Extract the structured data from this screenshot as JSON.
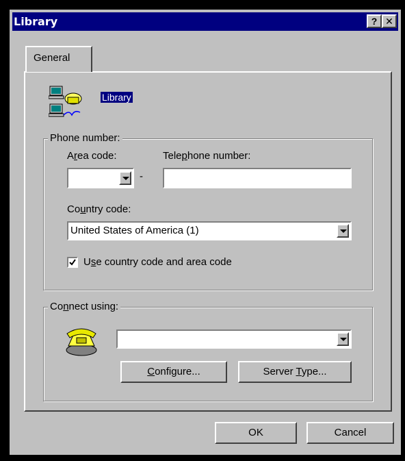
{
  "window": {
    "title": "Library",
    "help_button": "?",
    "close_button": "✕"
  },
  "tabs": [
    {
      "label": "General"
    }
  ],
  "header": {
    "connection_name": "Library",
    "icon": "network-computers-icon"
  },
  "phone_group": {
    "legend": "Phone number:",
    "area_code_label_pre": "A",
    "area_code_label_u": "r",
    "area_code_label_post": "ea code:",
    "area_code_value": "",
    "dash": "-",
    "telephone_label_pre": "Tele",
    "telephone_label_u": "p",
    "telephone_label_post": "hone number:",
    "telephone_value": "",
    "country_label_pre": "Co",
    "country_label_u": "u",
    "country_label_post": "ntry code:",
    "country_value": "United States of America (1)",
    "use_codes_pre": "U",
    "use_codes_u": "s",
    "use_codes_post": "e country code and area code",
    "use_codes_checked": true
  },
  "connect_group": {
    "legend_pre": "Co",
    "legend_u": "n",
    "legend_post": "nect using:",
    "device_value": "",
    "icon": "telephone-icon",
    "configure_u": "C",
    "configure_post": "onfigure...",
    "server_pre": "Server ",
    "server_u": "T",
    "server_post": "ype..."
  },
  "footer": {
    "ok_label": "OK",
    "cancel_label": "Cancel"
  },
  "colors": {
    "titlebar": "#000080",
    "face": "#c0c0c0",
    "highlight": "#000080"
  }
}
